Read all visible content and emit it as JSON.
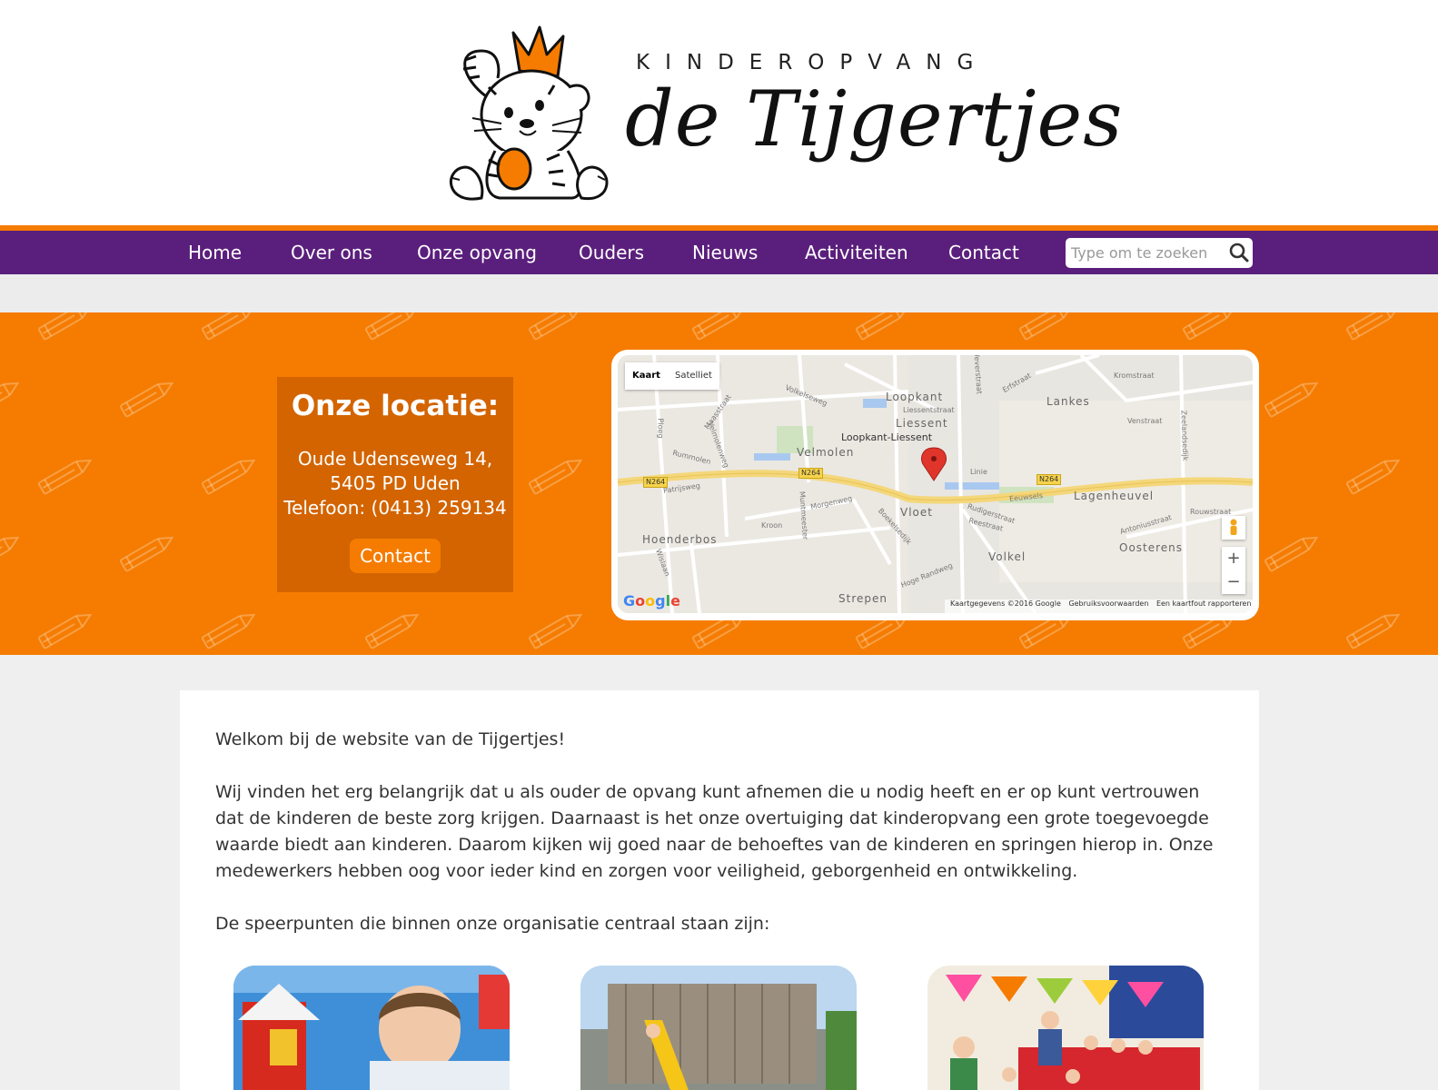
{
  "header": {
    "logo_top": "KINDEROPVANG",
    "logo_name": "de Tijgertjes"
  },
  "nav": {
    "items": [
      "Home",
      "Over ons",
      "Onze opvang",
      "Ouders",
      "Nieuws",
      "Activiteiten",
      "Contact"
    ],
    "search_placeholder": "Type om te zoeken"
  },
  "location": {
    "title": "Onze locatie:",
    "address_line1": "Oude Udenseweg 14,",
    "address_line2": "5405 PD Uden",
    "phone": "Telefoon: (0413) 259134",
    "button": "Contact"
  },
  "map": {
    "tabs": [
      "Kaart",
      "Satelliet"
    ],
    "labels": {
      "loopkant": "Loopkant",
      "liessent": "Liessent",
      "loopkant_liessent": "Loopkant-Liessent",
      "lankes": "Lankes",
      "velmolen": "Velmolen",
      "vloet": "Vloet",
      "lagenheuvel": "Lagenheuvel",
      "hoenderbos": "Hoenderbos",
      "volkel": "Volkel",
      "oosterens": "Oosterens",
      "strepen": "Strepen",
      "kromstraat": "Kromstraat",
      "erfstraat": "Erfstraat",
      "venstraat": "Venstraat",
      "zeelandsedijk": "Zeelandsedijk",
      "volkelseweg": "Volkelseweg",
      "maasstraat": "Maasstraat",
      "ploeg": "Ploeg",
      "rummolen": "Rummolen",
      "velmolenweg": "Velmolenweg",
      "patrijsweg": "Patrijsweg",
      "morgenweg": "Morgenweg",
      "kroon": "Kroon",
      "muntmeester": "Muntmeester",
      "linie": "Linie",
      "eeuwsels": "Eeuwsels",
      "rudigerstraat": "Rudigerstraat",
      "reestraat": "Reestraat",
      "antoniusstraat": "Antoniusstraat",
      "rouwstraat": "Rouwstraat",
      "boekelsedijk": "Boekelsedijk",
      "hoge_randweg": "Hoge Randweg",
      "liessentstraat": "Liessentstraat",
      "wevershraat": "Weverstraat",
      "wislaan": "Wislaan"
    },
    "road": "N264",
    "zoom_in": "+",
    "zoom_out": "−",
    "footer_data": "Kaartgegevens ©2016 Google",
    "footer_terms": "Gebruiksvoorwaarden",
    "footer_report": "Een kaartfout rapporteren",
    "google": "Google"
  },
  "content": {
    "welcome": "Welkom bij de website van de Tijgertjes!",
    "intro": "Wij vinden het erg belangrijk dat u als ouder de opvang kunt afnemen die u nodig heeft en er op kunt vertrouwen dat de kinderen de beste zorg krijgen. Daarnaast is het onze overtuiging dat kinderopvang een grote toegevoegde waarde biedt aan kinderen. Daarom kijken wij goed naar de behoeftes van de kinderen en springen hierop in. Onze medewerkers hebben oog voor ieder kind en zorgen voor veiligheid, geborgenheid en ontwikkeling.",
    "speerpunten": "De speerpunten die binnen onze organisatie centraal staan zijn:"
  },
  "colors": {
    "orange": "#f57c00",
    "dark_orange": "#d36400",
    "purple": "#5a1f7c"
  }
}
